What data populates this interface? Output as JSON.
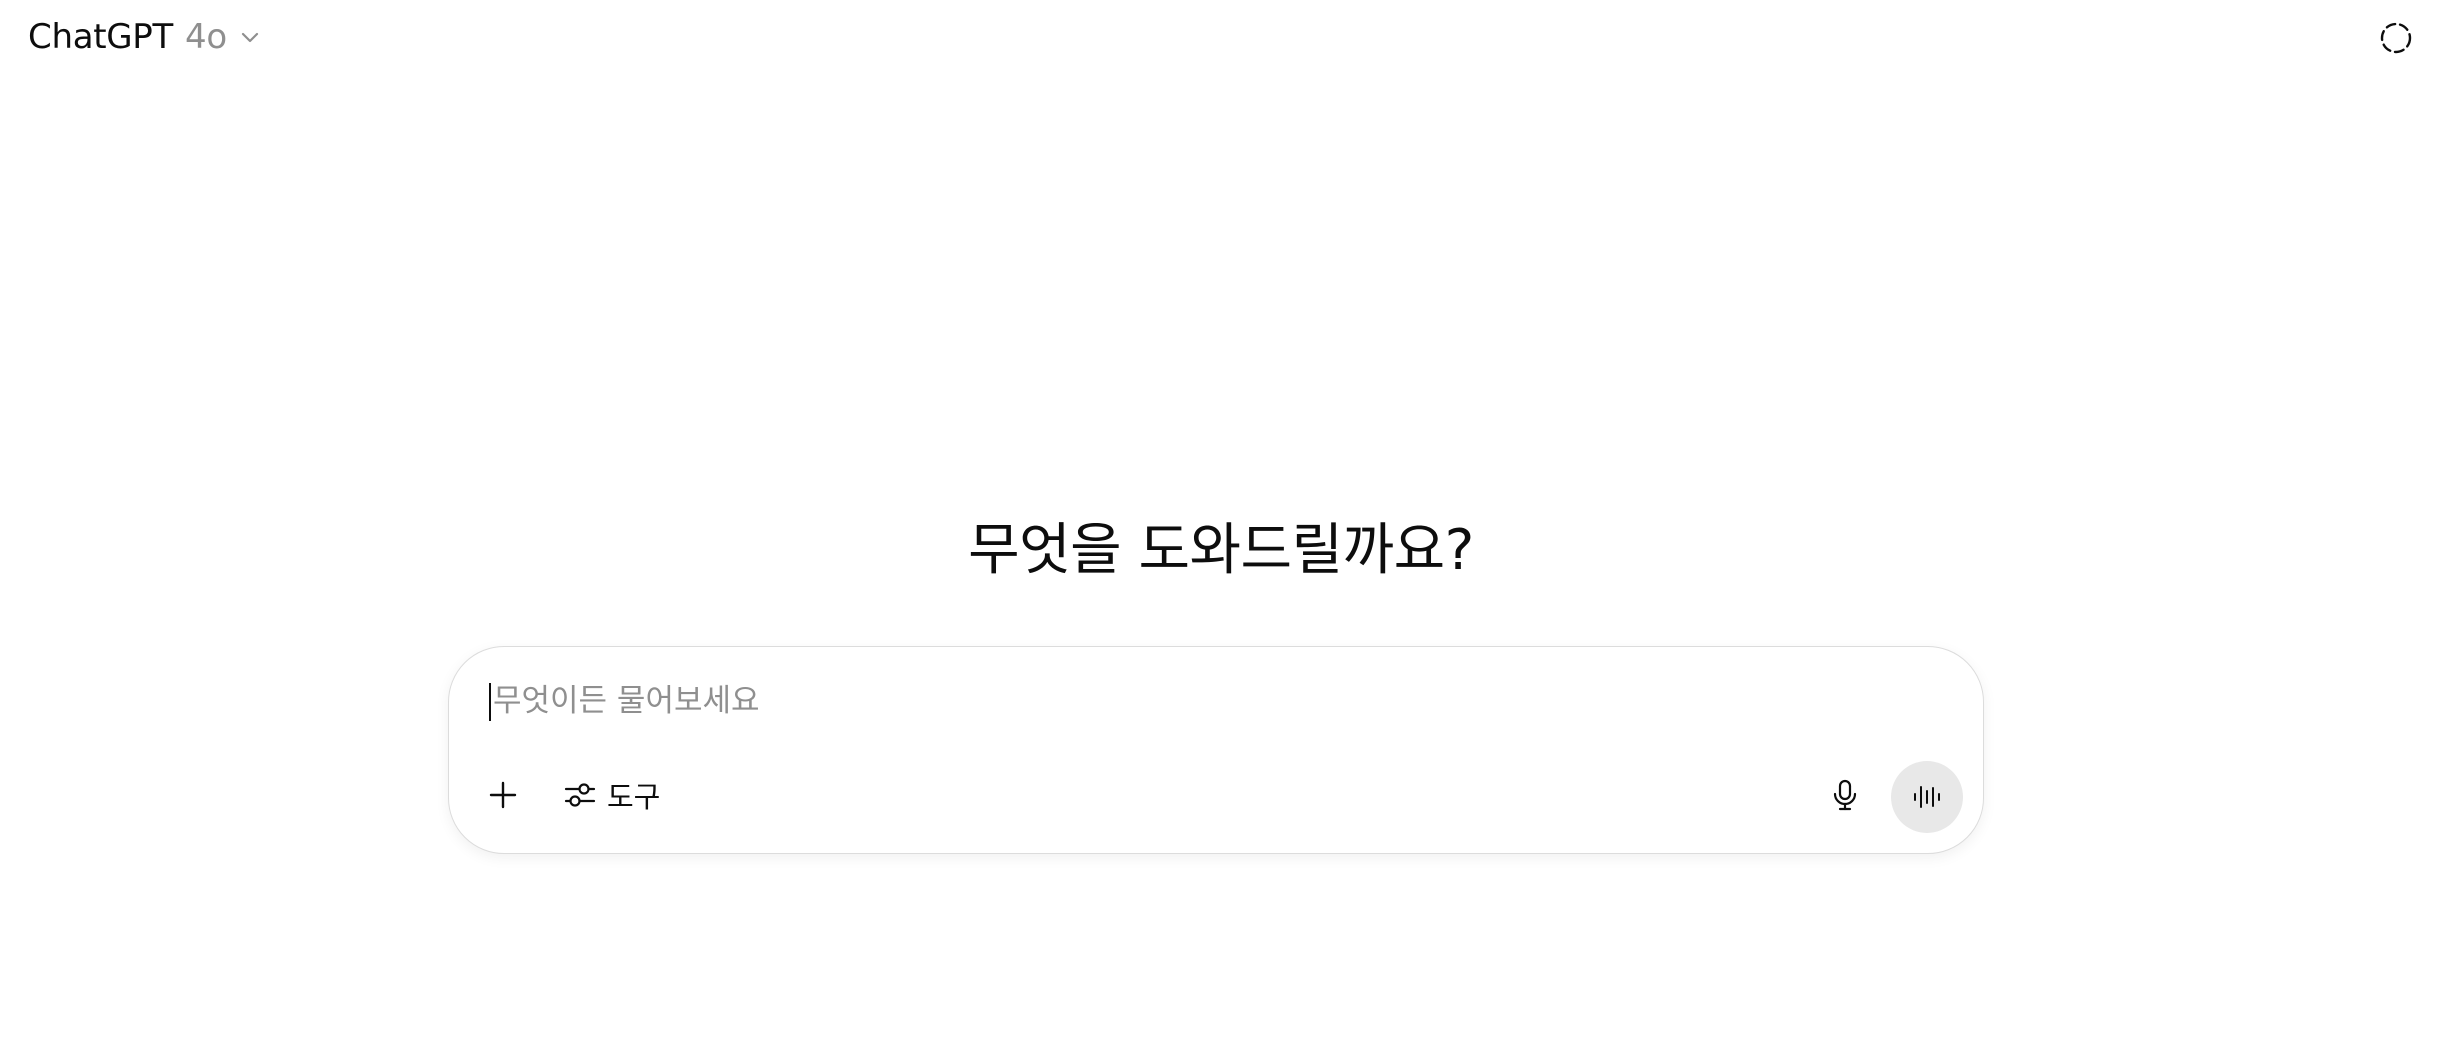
{
  "header": {
    "model_name": "ChatGPT",
    "model_version": "4o",
    "model_switcher_icon": "chevron-down-icon",
    "temporary_chat_icon": "dashed-circle-icon"
  },
  "main": {
    "greeting": "무엇을 도와드릴까요?"
  },
  "composer": {
    "placeholder": "무엇이든 물어보세요",
    "value": "",
    "attach_icon": "plus-icon",
    "tools_label": "도구",
    "tools_icon": "sliders-icon",
    "mic_icon": "microphone-icon",
    "voice_icon": "voice-waveform-icon"
  },
  "colors": {
    "text": "#0d0d0d",
    "muted": "#8f8f8f",
    "border": "#dcdcdc",
    "voice_button_bg": "#e8e8e8",
    "background": "#ffffff"
  }
}
